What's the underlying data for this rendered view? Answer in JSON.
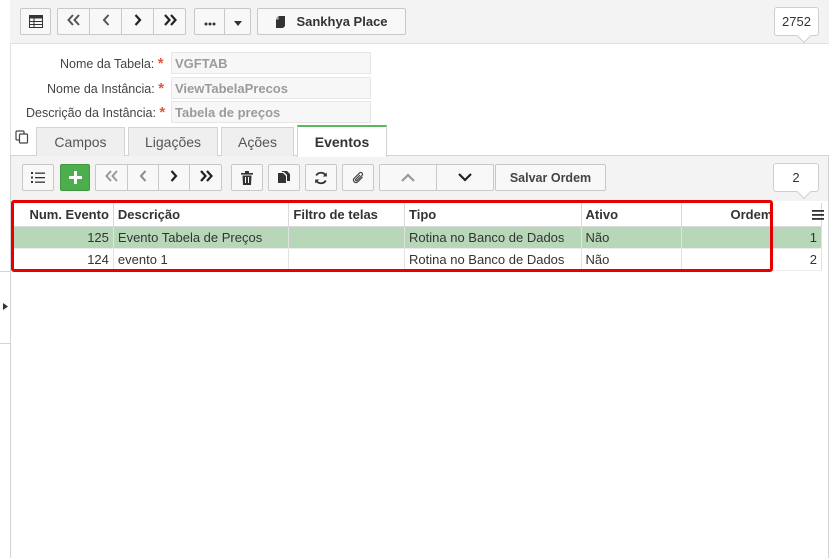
{
  "toolbar": {
    "place_button": "Sankhya Place",
    "counter": "2752"
  },
  "form": {
    "fields": [
      {
        "label": "Nome da Tabela:",
        "value": "VGFTAB"
      },
      {
        "label": "Nome da Instância:",
        "value": "ViewTabelaPrecos"
      },
      {
        "label": "Descrição da Instância:",
        "value": "Tabela de preços"
      }
    ],
    "required_mark": "*"
  },
  "tabs": [
    {
      "label": "Campos",
      "active": false
    },
    {
      "label": "Ligações",
      "active": false
    },
    {
      "label": "Ações",
      "active": false
    },
    {
      "label": "Eventos",
      "active": true
    }
  ],
  "grid_toolbar": {
    "save_order": "Salvar Ordem",
    "counter": "2"
  },
  "table": {
    "columns": [
      "Num. Evento",
      "Descrição",
      "Filtro de telas",
      "Tipo",
      "Ativo",
      "Ordem"
    ],
    "rows": [
      {
        "num": "125",
        "descricao": "Evento Tabela de Preços",
        "filtro": "",
        "tipo": "Rotina no Banco de Dados",
        "ativo": "Não",
        "ordem": "1",
        "selected": true
      },
      {
        "num": "124",
        "descricao": "evento 1",
        "filtro": "",
        "tipo": "Rotina no Banco de Dados",
        "ativo": "Não",
        "ordem": "2",
        "selected": false
      }
    ]
  },
  "colors": {
    "accent_green": "#5cb85c",
    "selected_row": "#b8d7b8",
    "highlight_red": "#e60000",
    "required_red": "#e2573b"
  }
}
